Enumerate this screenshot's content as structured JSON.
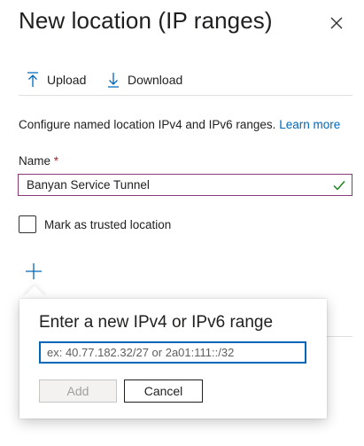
{
  "header": {
    "title": "New location (IP ranges)"
  },
  "toolbar": {
    "upload_label": "Upload",
    "download_label": "Download"
  },
  "description": {
    "text": "Configure named location IPv4 and IPv6 ranges.",
    "link": "Learn more"
  },
  "name_field": {
    "label": "Name",
    "required_mark": "*",
    "value": "Banyan Service Tunnel"
  },
  "trusted": {
    "label": "Mark as trusted location",
    "checked": false
  },
  "add_range": {
    "title": "Enter a new IPv4 or IPv6 range",
    "placeholder": "ex: 40.77.182.32/27 or 2a01:111::/32",
    "add_label": "Add",
    "cancel_label": "Cancel"
  },
  "colors": {
    "accent": "#0067b8",
    "valid": "#107c10",
    "required": "#a4262c",
    "input_border": "#8a3a78"
  },
  "icons": [
    "close-icon",
    "upload-icon",
    "download-icon",
    "checkmark-icon",
    "plus-icon"
  ]
}
